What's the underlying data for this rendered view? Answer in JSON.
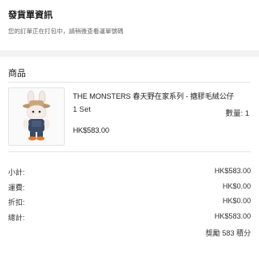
{
  "shipping": {
    "title": "發貨單資訊",
    "subtitle": "您的訂單正在打包中，請稍後查看運單號碼"
  },
  "products": {
    "section_title": "商品",
    "item": {
      "name": "THE MONSTERS 春天野在家系列 - 搪膠毛絨公仔",
      "variant": "1 Set",
      "quantity_text": "數量: 1",
      "price": "HK$583.00"
    }
  },
  "summary": {
    "rows": [
      {
        "label": "小計:",
        "value": "HK$583.00"
      },
      {
        "label": "運費:",
        "value": "HK$0.00"
      },
      {
        "label": "折扣:",
        "value": "HK$0.00"
      },
      {
        "label": "總計:",
        "value": "HK$583.00"
      }
    ],
    "reward_points": "獎勵 583 積分"
  }
}
